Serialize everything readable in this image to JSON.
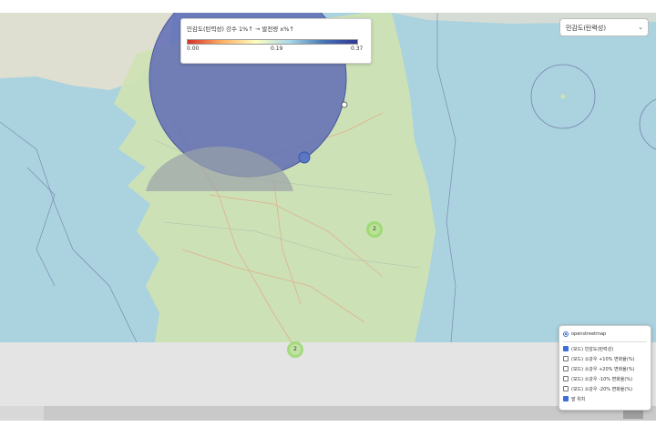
{
  "legend": {
    "title": "민감도(탄력성) 강수 1%↑ → 발전량 x%↑",
    "ticks": [
      "0.00",
      "0.19",
      "0.37"
    ],
    "gradient_colors": [
      "#d73027",
      "#fdae61",
      "#ffffbf",
      "#abd9e9",
      "#4575b4",
      "#313695"
    ]
  },
  "layer_select": {
    "selected": "민감도(탄력성)"
  },
  "clusters": [
    {
      "label": "2"
    },
    {
      "label": "2"
    }
  ],
  "layer_control": {
    "base_layers": [
      {
        "label": "openstreetmap",
        "selected": true
      }
    ],
    "overlays": [
      {
        "label": "(모드) 민감도(탄력성)",
        "checked": true
      },
      {
        "label": "(모드) 소강우 +10% 변화율(%)",
        "checked": false
      },
      {
        "label": "(모드) 소강우 +20% 변화율(%)",
        "checked": false
      },
      {
        "label": "(모드) 소강우 -10% 변화율(%)",
        "checked": false
      },
      {
        "label": "(모드) 소강우 -20% 변화율(%)",
        "checked": false
      },
      {
        "label": "발 위치",
        "checked": true
      }
    ]
  },
  "colors": {
    "sea": "#aad3df",
    "land": "#cfe2b4",
    "large_circle": "#5b68b5",
    "secondary_circle": "#9aa3a8",
    "cluster": "#b5e28c"
  }
}
